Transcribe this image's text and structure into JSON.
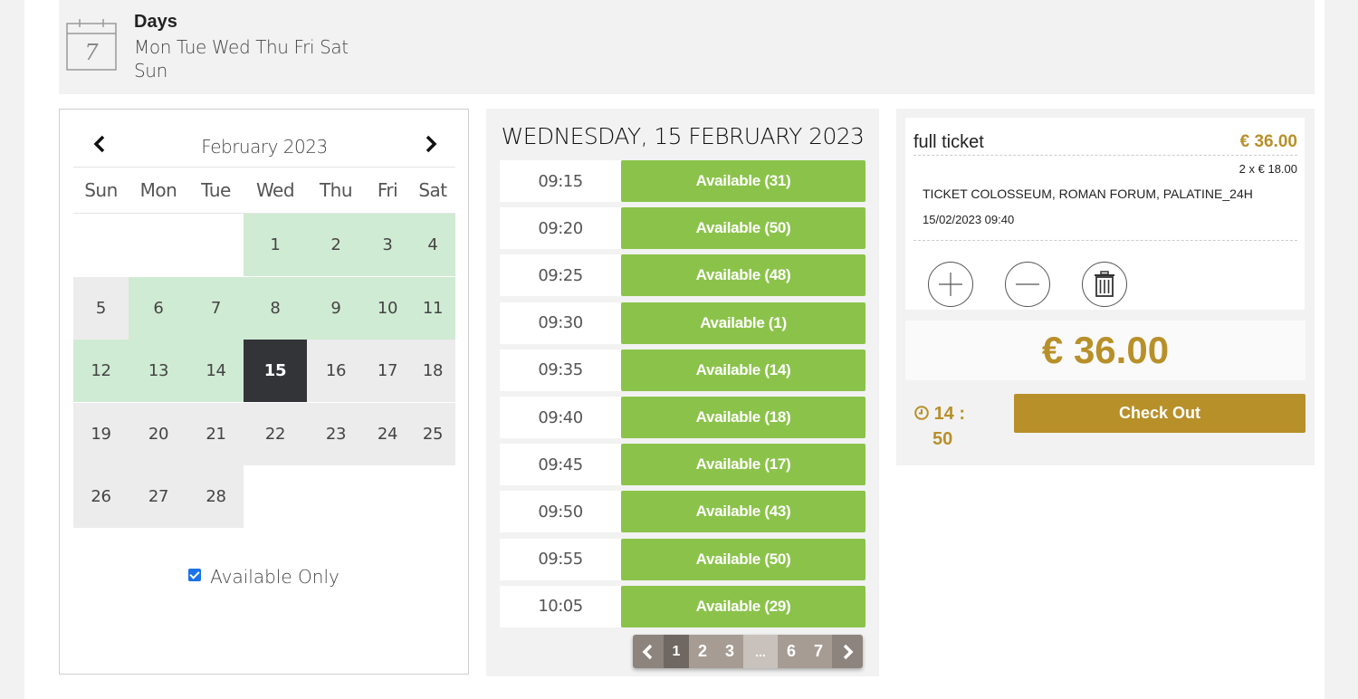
{
  "days": {
    "title": "Days",
    "list": "Mon Tue Wed Thu Fri Sat Sun",
    "icon_number": "7",
    "icon": "calendar-icon"
  },
  "calendar": {
    "month": "February 2023",
    "prev_icon": "chevron-left-icon",
    "next_icon": "chevron-right-icon",
    "weekdays": [
      "Sun",
      "Mon",
      "Tue",
      "Wed",
      "Thu",
      "Fri",
      "Sat"
    ],
    "weeks": [
      [
        null,
        null,
        null,
        {
          "d": "1",
          "s": "avail"
        },
        {
          "d": "2",
          "s": "avail"
        },
        {
          "d": "3",
          "s": "avail"
        },
        {
          "d": "4",
          "s": "avail"
        }
      ],
      [
        {
          "d": "5",
          "s": "unavail"
        },
        {
          "d": "6",
          "s": "avail"
        },
        {
          "d": "7",
          "s": "avail"
        },
        {
          "d": "8",
          "s": "avail"
        },
        {
          "d": "9",
          "s": "avail"
        },
        {
          "d": "10",
          "s": "avail"
        },
        {
          "d": "11",
          "s": "avail"
        }
      ],
      [
        {
          "d": "12",
          "s": "avail"
        },
        {
          "d": "13",
          "s": "avail"
        },
        {
          "d": "14",
          "s": "avail"
        },
        {
          "d": "15",
          "s": "selected"
        },
        {
          "d": "16",
          "s": "unavail"
        },
        {
          "d": "17",
          "s": "unavail"
        },
        {
          "d": "18",
          "s": "unavail"
        }
      ],
      [
        {
          "d": "19",
          "s": "unavail"
        },
        {
          "d": "20",
          "s": "unavail"
        },
        {
          "d": "21",
          "s": "unavail"
        },
        {
          "d": "22",
          "s": "unavail"
        },
        {
          "d": "23",
          "s": "unavail"
        },
        {
          "d": "24",
          "s": "unavail"
        },
        {
          "d": "25",
          "s": "unavail"
        }
      ],
      [
        {
          "d": "26",
          "s": "unavail"
        },
        {
          "d": "27",
          "s": "unavail"
        },
        {
          "d": "28",
          "s": "unavail"
        },
        null,
        null,
        null,
        null
      ]
    ],
    "available_only_label": "Available Only",
    "available_only_checked": true,
    "colors": {
      "available": "#d0ebd3",
      "unavailable": "#ececec",
      "selected": "#333438"
    }
  },
  "slots": {
    "date_heading": "WEDNESDAY, 15 FEBRUARY 2023",
    "items": [
      {
        "time": "09:15",
        "label": "Available (31)"
      },
      {
        "time": "09:20",
        "label": "Available (50)"
      },
      {
        "time": "09:25",
        "label": "Available (48)"
      },
      {
        "time": "09:30",
        "label": "Available (1)"
      },
      {
        "time": "09:35",
        "label": "Available (14)"
      },
      {
        "time": "09:40",
        "label": "Available (18)"
      },
      {
        "time": "09:45",
        "label": "Available (17)"
      },
      {
        "time": "09:50",
        "label": "Available (43)"
      },
      {
        "time": "09:55",
        "label": "Available (50)"
      },
      {
        "time": "10:05",
        "label": "Available (29)"
      }
    ],
    "pagination": {
      "prev_icon": "chevron-left-icon",
      "next_icon": "chevron-right-icon",
      "current": "1",
      "pages": [
        "1",
        "2",
        "3",
        "...",
        "6",
        "7"
      ]
    },
    "colors": {
      "button": "#8bc34a"
    }
  },
  "cart": {
    "item_name": "full ticket",
    "item_price": "€ 36.00",
    "item_qty": "2 x € 18.00",
    "item_desc": "TICKET COLOSSEUM, ROMAN FORUM, PALATINE_24H",
    "item_datetime": "15/02/2023 09:40",
    "actions": [
      "plus-icon",
      "minus-icon",
      "trash-icon"
    ],
    "total": "€ 36.00",
    "timer_icon": "clock-icon",
    "timer_min": "14 :",
    "timer_sec": "50",
    "checkout_label": "Check Out",
    "colors": {
      "accent": "#b8902a"
    }
  }
}
